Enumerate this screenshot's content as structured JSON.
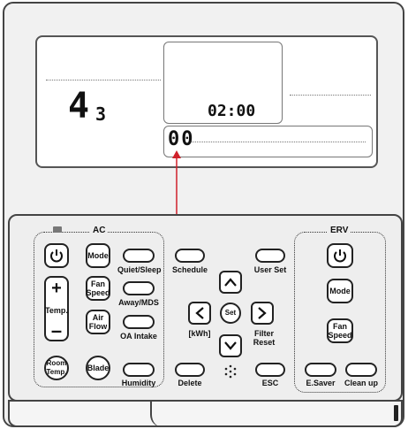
{
  "display": {
    "main_digit": "4",
    "sub_digit": "3",
    "time": "02:00",
    "bottom_code": "00"
  },
  "ac_group": {
    "label": "AC",
    "power_label": "",
    "mode": "Mode",
    "quiet_sleep": "Quiet/Sleep",
    "fan_speed": "Fan\nSpeed",
    "away_mds": "Away/MDS",
    "temp": "Temp.",
    "air_flow": "Air\nFlow",
    "oa_intake": "OA Intake",
    "room_temp": "Room\nTemp.",
    "blade": "Blade",
    "humidity": "Humidity"
  },
  "center": {
    "schedule": "Schedule",
    "user_set": "User Set",
    "kwh": "[kWh]",
    "set": "Set",
    "filter_reset": "Filter\nReset",
    "delete": "Delete",
    "esc": "ESC"
  },
  "erv_group": {
    "label": "ERV",
    "mode": "Mode",
    "fan_speed": "Fan\nSpeed",
    "esaver": "E.Saver",
    "clean_up": "Clean up"
  },
  "colors": {
    "indicator_arrow": "#d0202a"
  }
}
